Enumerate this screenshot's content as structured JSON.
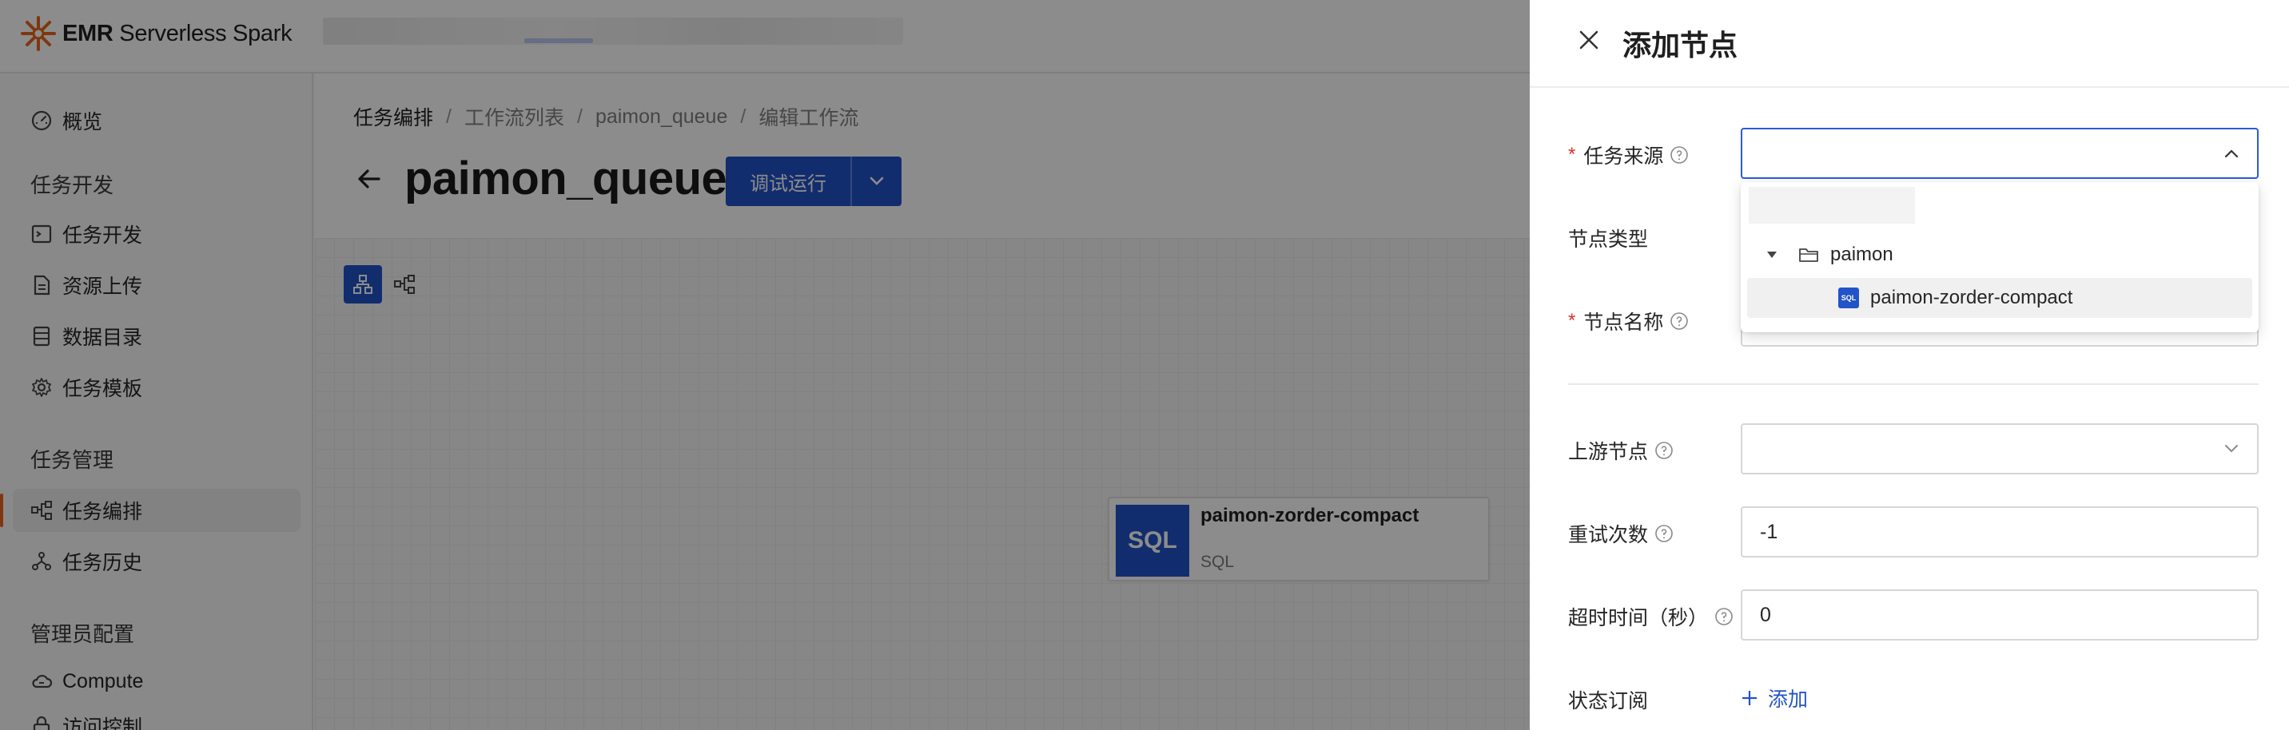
{
  "app": {
    "brand_bold": "EMR",
    "brand_rest": " Serverless Spark"
  },
  "sidebar": {
    "overview": "概览",
    "section_dev": "任务开发",
    "dev_items": [
      "任务开发",
      "资源上传",
      "数据目录",
      "任务模板"
    ],
    "section_mgmt": "任务管理",
    "mgmt_items": [
      "任务编排",
      "任务历史"
    ],
    "section_admin": "管理员配置",
    "admin_items": [
      "Compute",
      "访问控制"
    ]
  },
  "breadcrumb": [
    "任务编排",
    "工作流列表",
    "paimon_queue",
    "编辑工作流"
  ],
  "page": {
    "title": "paimon_queue",
    "run_button": "调试运行"
  },
  "node": {
    "badge": "SQL",
    "name": "paimon-zorder-compact",
    "type": "SQL"
  },
  "drawer": {
    "title": "添加节点",
    "fields": {
      "task_source": "任务来源",
      "node_type": "节点类型",
      "node_name": "节点名称",
      "upstream": "上游节点",
      "retry": "重试次数",
      "retry_value": "-1",
      "timeout": "超时时间（秒）",
      "timeout_value": "0",
      "subscription": "状态订阅",
      "add": "添加"
    },
    "dropdown": {
      "folder": "paimon",
      "file": "paimon-zorder-compact",
      "file_icon": "SQL"
    }
  },
  "colors": {
    "accent": "#2253c8",
    "brand_orange": "#e8651c",
    "required": "#e0302e"
  }
}
